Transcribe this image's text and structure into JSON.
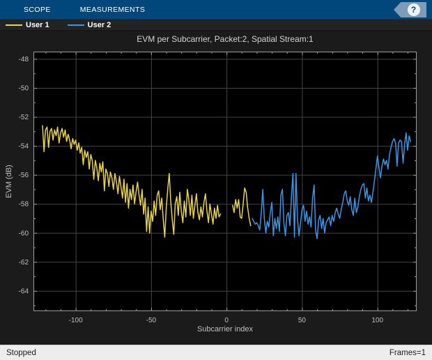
{
  "toolstrip": {
    "tabs": [
      {
        "label": "SCOPE"
      },
      {
        "label": "MEASUREMENTS"
      }
    ],
    "help_label": "?"
  },
  "legend": {
    "entries": [
      {
        "label": "User 1",
        "color": "#e8d44a"
      },
      {
        "label": "User 2",
        "color": "#3a96e8"
      }
    ]
  },
  "status_bar": {
    "left": "Stopped",
    "right": "Frames=1"
  },
  "chart_data": {
    "type": "line",
    "title": "EVM per Subcarrier, Packet:2, Spatial Stream:1",
    "xlabel": "Subcarrier index",
    "ylabel": "EVM (dB)",
    "xlim": [
      -128,
      126
    ],
    "ylim": [
      -65.4,
      -47.5
    ],
    "xticks": [
      -100,
      -50,
      0,
      50,
      100
    ],
    "yticks": [
      -64,
      -62,
      -60,
      -58,
      -56,
      -54,
      -52,
      -50,
      -48
    ],
    "x_minor_step": 10,
    "y_minor_step": 1,
    "grid": true,
    "colors": {
      "axes_bg": "#000000",
      "grid": "#454545",
      "border": "#9e9e9e",
      "toolstrip_bg": "#02477b",
      "status_bg": "#ededed"
    },
    "series": [
      {
        "name": "User 1",
        "color": "#e8d44a",
        "segments": [
          [
            [
              -122,
              -52.6
            ],
            [
              -121,
              -54.4
            ],
            [
              -120,
              -52.9
            ],
            [
              -119,
              -52.7
            ],
            [
              -118,
              -54.1
            ],
            [
              -117,
              -53.0
            ],
            [
              -116,
              -52.8
            ],
            [
              -115,
              -53.6
            ],
            [
              -114,
              -52.9
            ],
            [
              -113,
              -53.3
            ],
            [
              -112,
              -52.7
            ],
            [
              -111,
              -53.8
            ],
            [
              -110,
              -53.1
            ],
            [
              -109,
              -52.8
            ],
            [
              -108,
              -53.4
            ],
            [
              -107,
              -52.9
            ],
            [
              -106,
              -53.7
            ],
            [
              -105,
              -53.2
            ],
            [
              -104,
              -53.6
            ],
            [
              -103,
              -54.2
            ],
            [
              -102,
              -53.5
            ],
            [
              -101,
              -53.9
            ],
            [
              -100,
              -53.6
            ],
            [
              -99,
              -54.3
            ],
            [
              -98,
              -53.8
            ],
            [
              -97,
              -54.5
            ],
            [
              -96,
              -54.1
            ],
            [
              -95,
              -55.3
            ],
            [
              -94,
              -54.3
            ],
            [
              -93,
              -54.8
            ],
            [
              -92,
              -54.4
            ],
            [
              -91,
              -55.6
            ],
            [
              -90,
              -54.6
            ],
            [
              -89,
              -55.0
            ],
            [
              -88,
              -56.3
            ],
            [
              -87,
              -55.0
            ],
            [
              -86,
              -55.5
            ],
            [
              -85,
              -56.4
            ],
            [
              -84,
              -55.2
            ],
            [
              -83,
              -55.8
            ],
            [
              -82,
              -55.1
            ],
            [
              -81,
              -57.1
            ],
            [
              -80,
              -55.6
            ],
            [
              -79,
              -55.9
            ],
            [
              -78,
              -56.8
            ],
            [
              -77,
              -55.8
            ],
            [
              -76,
              -56.2
            ],
            [
              -75,
              -57.0
            ],
            [
              -74,
              -55.9
            ],
            [
              -73,
              -56.5
            ],
            [
              -72,
              -57.3
            ],
            [
              -71,
              -56.1
            ],
            [
              -70,
              -56.8
            ],
            [
              -69,
              -57.6
            ],
            [
              -68,
              -56.3
            ],
            [
              -67,
              -57.9
            ],
            [
              -66,
              -56.6
            ],
            [
              -65,
              -58.3
            ],
            [
              -64,
              -57.0
            ],
            [
              -63,
              -57.7
            ],
            [
              -62,
              -56.7
            ],
            [
              -61,
              -58.0
            ],
            [
              -60,
              -57.2
            ],
            [
              -59,
              -56.5
            ],
            [
              -58,
              -57.4
            ],
            [
              -57,
              -58.1
            ],
            [
              -56,
              -57.0
            ],
            [
              -55,
              -58.7
            ],
            [
              -54,
              -57.6
            ],
            [
              -53,
              -59.9
            ],
            [
              -52,
              -58.2
            ],
            [
              -51,
              -60.0
            ],
            [
              -50,
              -58.5
            ],
            [
              -49,
              -59.2
            ],
            [
              -48,
              -57.8
            ],
            [
              -47,
              -58.8
            ],
            [
              -46,
              -57.4
            ],
            [
              -45,
              -57.1
            ],
            [
              -44,
              -58.4
            ],
            [
              -43,
              -57.6
            ],
            [
              -42,
              -59.0
            ],
            [
              -41,
              -60.3
            ],
            [
              -40,
              -58.3
            ],
            [
              -39,
              -57.0
            ],
            [
              -38,
              -55.9
            ],
            [
              -37,
              -57.8
            ],
            [
              -36,
              -59.1
            ],
            [
              -35,
              -60.1
            ],
            [
              -34,
              -58.0
            ],
            [
              -33,
              -57.5
            ],
            [
              -32,
              -58.8
            ],
            [
              -31,
              -57.2
            ],
            [
              -30,
              -58.5
            ],
            [
              -29,
              -59.3
            ],
            [
              -28,
              -57.8
            ],
            [
              -27,
              -58.9
            ],
            [
              -26,
              -57.0
            ],
            [
              -25,
              -57.7
            ],
            [
              -24,
              -58.8
            ],
            [
              -23,
              -57.4
            ],
            [
              -22,
              -59.0
            ],
            [
              -21,
              -58.1
            ],
            [
              -20,
              -57.3
            ],
            [
              -19,
              -58.6
            ],
            [
              -18,
              -59.1
            ],
            [
              -17,
              -58.2
            ],
            [
              -16,
              -58.9
            ],
            [
              -15,
              -57.9
            ],
            [
              -14,
              -57.3
            ],
            [
              -13,
              -58.5
            ],
            [
              -12,
              -59.3
            ],
            [
              -11,
              -58.0
            ],
            [
              -10,
              -58.7
            ],
            [
              -9,
              -59.4
            ],
            [
              -8,
              -58.3
            ],
            [
              -7,
              -59.0
            ],
            [
              -6,
              -58.1
            ],
            [
              -5,
              -58.9
            ],
            [
              -4,
              -58.7
            ]
          ],
          [
            [
              4,
              -58.1
            ],
            [
              5,
              -58.6
            ],
            [
              6,
              -57.7
            ],
            [
              7,
              -58.3
            ],
            [
              8,
              -57.7
            ],
            [
              9,
              -58.9
            ],
            [
              10,
              -59.0
            ],
            [
              11,
              -58.0
            ],
            [
              12,
              -56.9
            ],
            [
              13,
              -57.2
            ],
            [
              14,
              -58.3
            ],
            [
              15,
              -59.0
            ],
            [
              16,
              -59.5
            ]
          ]
        ]
      },
      {
        "name": "User 2",
        "color": "#3a96e8",
        "segments": [
          [
            [
              17,
              -59.0
            ],
            [
              18,
              -59.2
            ],
            [
              19,
              -59.4
            ],
            [
              20,
              -59.3
            ],
            [
              21,
              -59.5
            ],
            [
              22,
              -59.8
            ],
            [
              23,
              -58.6
            ],
            [
              24,
              -57.0
            ],
            [
              25,
              -59.0
            ],
            [
              26,
              -60.0
            ],
            [
              27,
              -59.2
            ],
            [
              28,
              -59.6
            ],
            [
              29,
              -58.6
            ],
            [
              30,
              -57.9
            ],
            [
              31,
              -60.2
            ],
            [
              32,
              -59.0
            ],
            [
              33,
              -59.7
            ],
            [
              34,
              -58.9
            ],
            [
              35,
              -59.9
            ],
            [
              36,
              -57.4
            ],
            [
              37,
              -57.0
            ],
            [
              38,
              -59.3
            ],
            [
              39,
              -60.2
            ],
            [
              40,
              -58.8
            ],
            [
              41,
              -58.6
            ],
            [
              42,
              -59.5
            ],
            [
              43,
              -57.5
            ],
            [
              44,
              -55.9
            ],
            [
              45,
              -60.3
            ],
            [
              46,
              -55.9
            ],
            [
              47,
              -59.0
            ],
            [
              48,
              -60.2
            ],
            [
              49,
              -59.3
            ],
            [
              50,
              -58.4
            ],
            [
              51,
              -58.1
            ],
            [
              52,
              -59.2
            ],
            [
              53,
              -58.5
            ],
            [
              54,
              -59.4
            ],
            [
              55,
              -58.9
            ],
            [
              56,
              -59.6
            ],
            [
              57,
              -57.6
            ],
            [
              58,
              -56.7
            ],
            [
              59,
              -59.8
            ],
            [
              60,
              -60.4
            ],
            [
              61,
              -59.1
            ],
            [
              62,
              -58.8
            ],
            [
              63,
              -59.7
            ],
            [
              64,
              -59.0
            ],
            [
              65,
              -60.0
            ],
            [
              66,
              -59.3
            ],
            [
              67,
              -59.1
            ],
            [
              68,
              -58.9
            ],
            [
              69,
              -59.5
            ],
            [
              70,
              -58.8
            ],
            [
              71,
              -59.2
            ],
            [
              72,
              -58.6
            ],
            [
              73,
              -58.3
            ],
            [
              74,
              -58.7
            ],
            [
              75,
              -59.0
            ],
            [
              76,
              -58.4
            ],
            [
              77,
              -57.9
            ],
            [
              78,
              -57.3
            ],
            [
              79,
              -57.1
            ],
            [
              80,
              -57.8
            ],
            [
              81,
              -58.1
            ],
            [
              82,
              -57.5
            ],
            [
              83,
              -58.4
            ],
            [
              84,
              -58.8
            ],
            [
              85,
              -57.6
            ],
            [
              86,
              -58.6
            ],
            [
              87,
              -58.2
            ],
            [
              88,
              -57.5
            ],
            [
              89,
              -57.0
            ],
            [
              90,
              -56.7
            ],
            [
              91,
              -56.6
            ],
            [
              92,
              -57.6
            ],
            [
              93,
              -56.9
            ],
            [
              94,
              -57.8
            ],
            [
              95,
              -57.4
            ],
            [
              96,
              -57.9
            ],
            [
              97,
              -57.2
            ],
            [
              98,
              -56.4
            ],
            [
              99,
              -55.6
            ],
            [
              100,
              -54.7
            ],
            [
              101,
              -55.5
            ],
            [
              102,
              -56.2
            ],
            [
              103,
              -55.4
            ],
            [
              104,
              -54.9
            ],
            [
              105,
              -55.3
            ],
            [
              106,
              -55.0
            ],
            [
              107,
              -55.6
            ],
            [
              108,
              -54.6
            ],
            [
              109,
              -54.1
            ],
            [
              110,
              -53.7
            ],
            [
              111,
              -53.5
            ],
            [
              112,
              -53.8
            ],
            [
              113,
              -55.4
            ],
            [
              114,
              -53.8
            ],
            [
              115,
              -53.6
            ],
            [
              116,
              -53.7
            ],
            [
              117,
              -55.2
            ],
            [
              118,
              -53.9
            ],
            [
              119,
              -53.1
            ],
            [
              120,
              -54.3
            ],
            [
              121,
              -53.3
            ],
            [
              122,
              -53.7
            ]
          ]
        ]
      }
    ]
  }
}
